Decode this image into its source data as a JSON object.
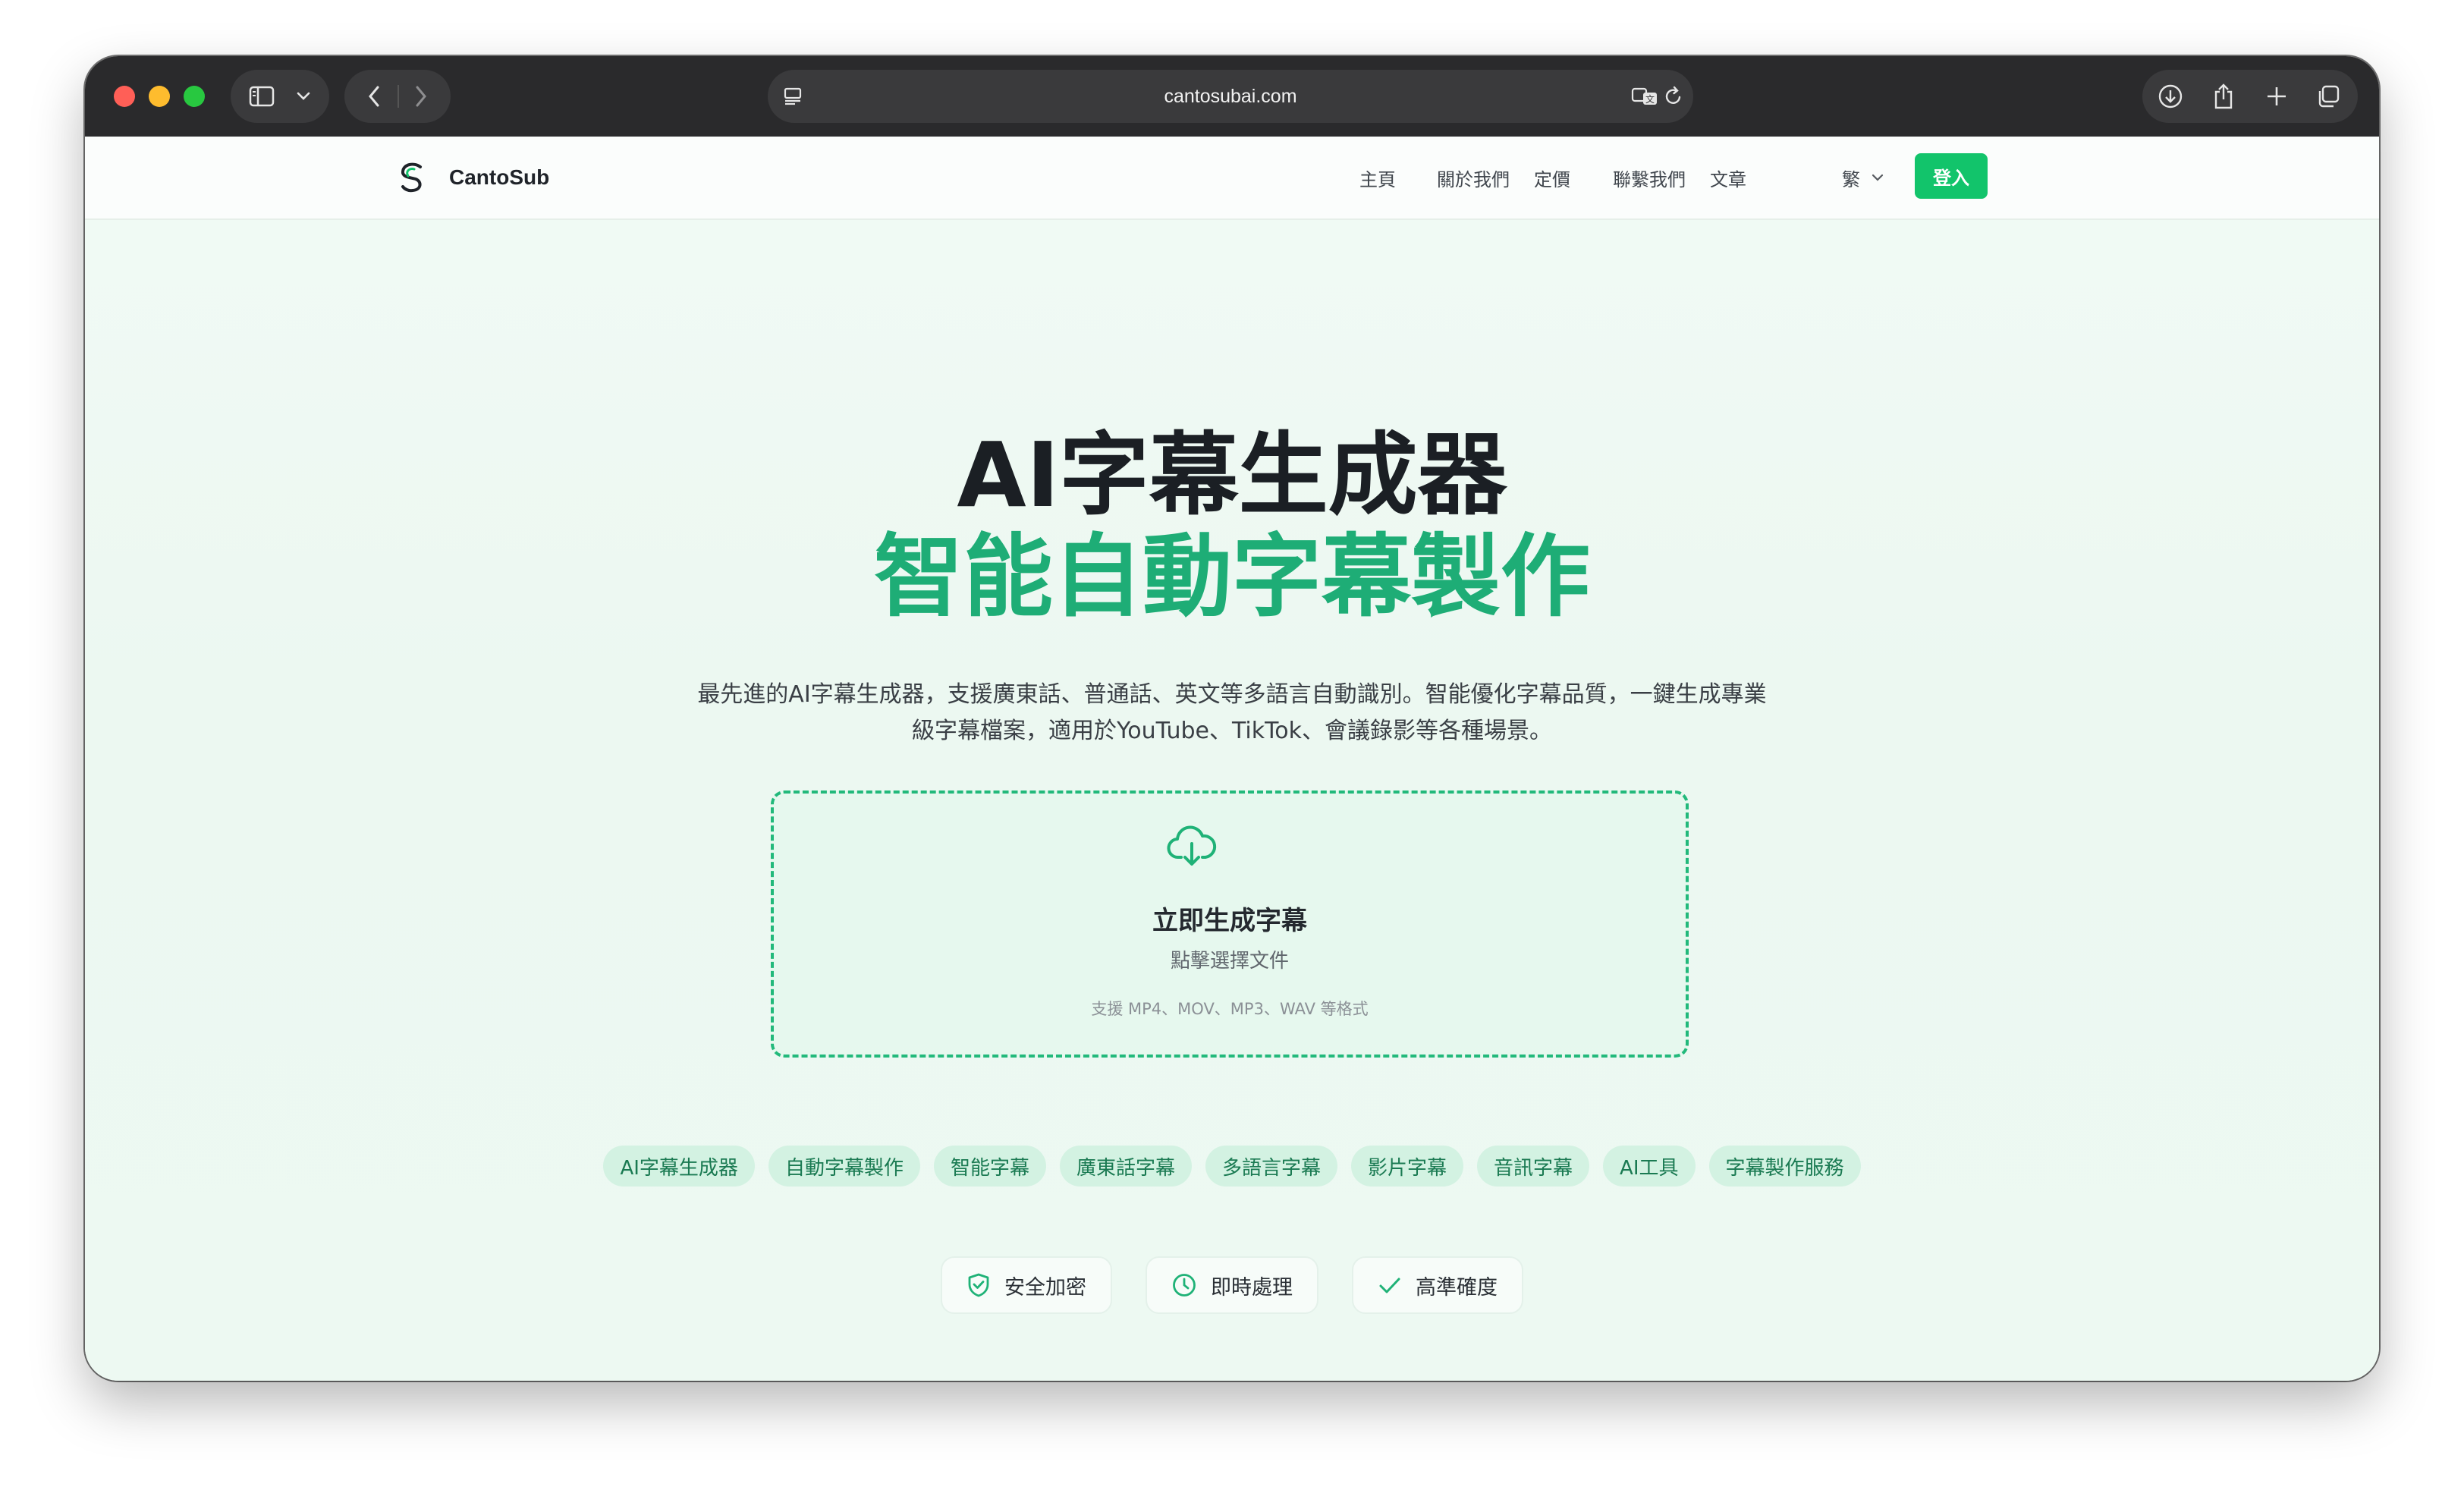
{
  "browser": {
    "url": "cantosubai.com"
  },
  "site": {
    "brand": "CantoSub",
    "nav": [
      "主頁",
      "關於我們",
      "定價",
      "聯繫我們",
      "文章"
    ],
    "language": "繁",
    "login_label": "登入",
    "accent_color": "#12c46b"
  },
  "hero": {
    "title": "AI字幕生成器",
    "subtitle": "智能自動字幕製作",
    "description_line1": "最先進的AI字幕生成器，支援廣東話、普通話、英文等多語言自動識別。智能優化字幕品質，一鍵生成專業",
    "description_line2": "級字幕檔案，適用於YouTube、TikTok、會議錄影等各種場景。"
  },
  "upload": {
    "title": "立即生成字幕",
    "subtitle": "點擊選擇文件",
    "formats": "支援 MP4、MOV、MP3、WAV 等格式"
  },
  "tags": [
    "AI字幕生成器",
    "自動字幕製作",
    "智能字幕",
    "廣東話字幕",
    "多語言字幕",
    "影片字幕",
    "音訊字幕",
    "AI工具",
    "字幕製作服務"
  ],
  "features": [
    {
      "icon": "shield-icon",
      "label": "安全加密"
    },
    {
      "icon": "clock-icon",
      "label": "即時處理"
    },
    {
      "icon": "check-icon",
      "label": "高準確度"
    }
  ]
}
